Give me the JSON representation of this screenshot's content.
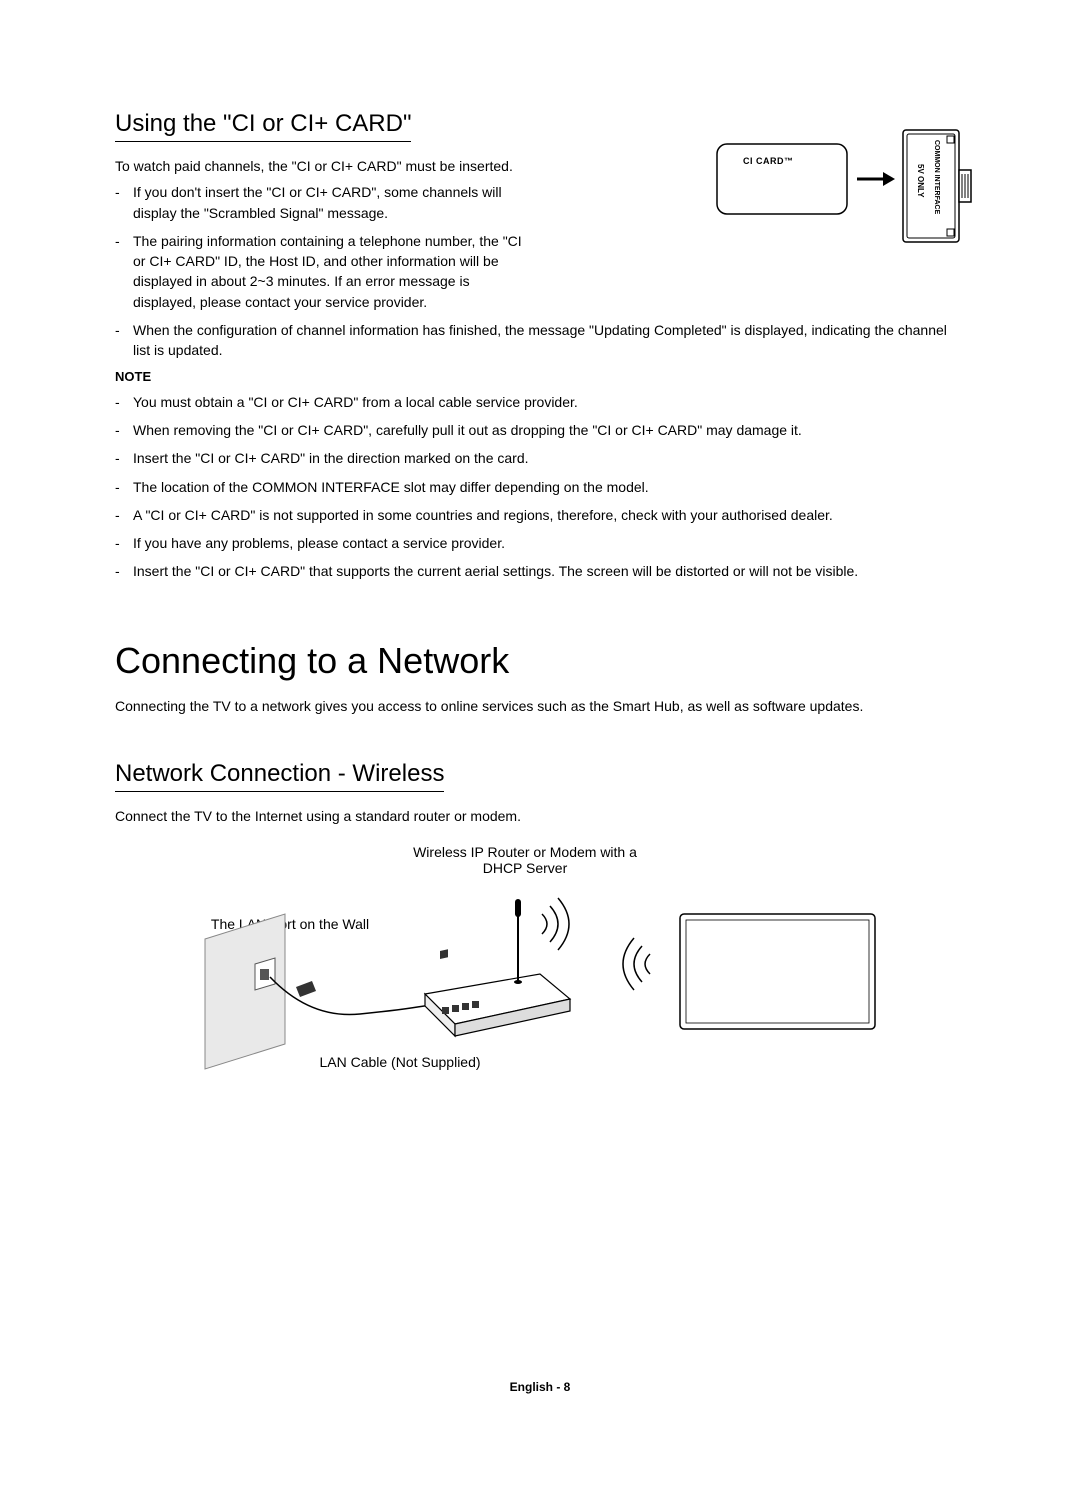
{
  "section1": {
    "heading": "Using the \"CI or CI+ CARD\"",
    "intro": "To watch paid channels, the \"CI or CI+ CARD\" must be inserted.",
    "bullets_narrow": [
      "If you don't insert the \"CI or CI+ CARD\", some channels will display the \"Scrambled Signal\" message.",
      "The pairing information containing a telephone number, the \"CI or CI+ CARD\" ID, the Host ID, and other information will be displayed in about 2~3 minutes. If an error message is displayed, please contact your service provider."
    ],
    "bullets_wide": [
      "When the configuration of channel information has finished, the message \"Updating Completed\" is displayed, indicating the channel list is updated."
    ],
    "note_label": "NOTE",
    "notes": [
      "You must obtain a \"CI or CI+ CARD\" from a local cable service provider.",
      "When removing the \"CI or CI+ CARD\", carefully pull it out as dropping the \"CI or CI+ CARD\" may damage it.",
      "Insert the \"CI or CI+ CARD\" in the direction marked on the card.",
      "The location of the COMMON INTERFACE slot may differ depending on the model.",
      "A \"CI or CI+ CARD\" is not supported in some countries and regions, therefore, check with your authorised dealer.",
      "If you have any problems, please contact a service provider.",
      "Insert the \"CI or CI+ CARD\" that supports the current aerial settings. The screen will be distorted or will not be visible."
    ],
    "diagram": {
      "card_label": "CI CARD™",
      "slot_label1": "5V ONLY",
      "slot_label2": "COMMON INTERFACE"
    }
  },
  "section2": {
    "heading": "Connecting to a Network",
    "intro": "Connecting the TV to a network gives you access to online services such as the Smart Hub, as well as software updates."
  },
  "section3": {
    "heading": "Network Connection - Wireless",
    "intro": "Connect the TV to the Internet using a standard router or modem.",
    "diagram": {
      "router_label": "Wireless IP Router or Modem with a DHCP Server",
      "wall_label": "The LAN Port on the Wall",
      "cable_label": "LAN Cable (Not Supplied)"
    }
  },
  "footer": "English - 8"
}
